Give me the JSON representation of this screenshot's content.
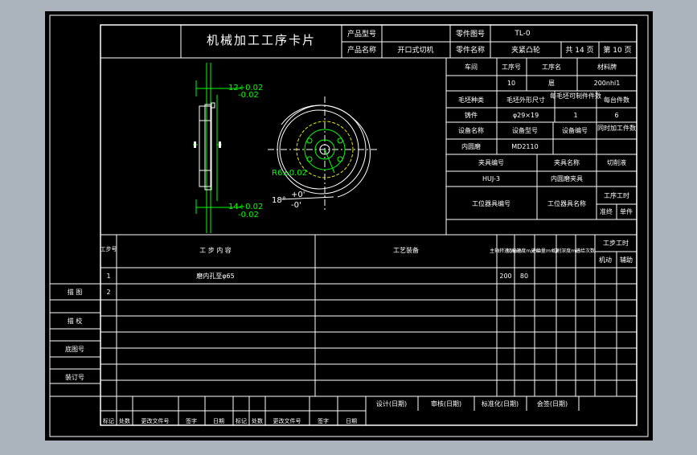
{
  "card": {
    "title": "机械加工工序卡片",
    "product_no_label": "产品型号",
    "product_no_value": "",
    "part_no_label": "零件图号",
    "part_no_value": "TL-0",
    "product_name_label": "产品名称",
    "product_name_value": "开口式切机",
    "part_name_label": "零件名称",
    "part_name_value": "夹紧凸轮",
    "total_pages": "共 14 页",
    "page_no": "第 10 页"
  },
  "info": {
    "workshop_label": "车间",
    "process_no_label": "工序号",
    "process_name_label": "工序名",
    "material_label": "材料牌",
    "workshop_value": "",
    "process_no_value": "10",
    "process_name_value": "扈",
    "material_value": "200nhl1",
    "blank_type_label": "毛坯种类",
    "blank_size_label": "毛坯外形尺寸",
    "blank_count_label": "每毛坯可制件件数",
    "per_machine_label": "每台件数",
    "blank_type_value": "铸件",
    "blank_size_value": "φ29×19",
    "blank_count_value": "1",
    "per_machine_value": "6",
    "equip_name_label": "设备名称",
    "equip_model_label": "设备型号",
    "equip_no_label": "设备编号",
    "simul_label": "同时加工件数",
    "equip_name_value": "内圆磨",
    "equip_model_value": "MD2110",
    "fixture_no_label": "夹具编号",
    "fixture_name_label": "夹具名称",
    "coolant_label": "切削液",
    "fixture_no_value": "HUJ-3",
    "fixture_name_value": "内圆磨夹具",
    "tool_no_label": "工位器具编号",
    "tool_name_label": "工位器具名称",
    "process_time_label": "工序工时",
    "prep_label": "准终",
    "unit_label": "单件"
  },
  "drawing": {
    "dim_top": "12+0.02",
    "dim_top_low": "-0.02",
    "dim_bottom": "14+0.02",
    "dim_bottom_low": "-0.02",
    "radius": "R6±0.02",
    "angle": "18°",
    "angle_up": "+0'",
    "angle_low": "-0'"
  },
  "steps": {
    "headers": {
      "step_no": "工步号",
      "step_content": "工 步 内 容",
      "equipment": "工艺装备",
      "spindle": "主轴转速r/min",
      "speed": "切削速度m/min",
      "feed": "进给量mm/r",
      "depth": "切削深度mm",
      "passes": "进给次数",
      "hours": "工步工时",
      "machine": "机动",
      "aux": "辅助"
    },
    "rows": [
      {
        "no": "1",
        "content": "磨内孔至φ65",
        "equip": "",
        "spindle": "200",
        "speed": "80"
      },
      {
        "no": "2",
        "content": "",
        "equip": "",
        "spindle": "",
        "speed": ""
      }
    ]
  },
  "side": {
    "draw": "描 图",
    "check": "描 校",
    "base_no": "底图号",
    "bind_no": "装订号"
  },
  "footer": {
    "mark": "标记",
    "count": "处数",
    "doc_no": "更改文件号",
    "sign": "签字",
    "date": "日期",
    "design": "设计(日期)",
    "review": "审核(日期)",
    "standard": "标准化(日期)",
    "approve": "会签(日期)"
  }
}
